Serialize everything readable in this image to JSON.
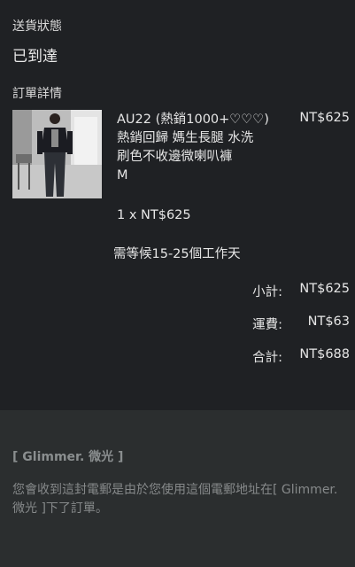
{
  "shipping": {
    "heading": "送貨狀態",
    "status": "已到達"
  },
  "order": {
    "heading": "訂單詳情",
    "item": {
      "name_line1": "AU22 (熱銷1000+♡♡♡)",
      "name_line2": "熱銷回歸 媽生長腿 水洗",
      "name_line3": "刷色不收邊微喇叭褲",
      "name_line4": "M",
      "price": "NT$625",
      "quantity_line": "1 x NT$625",
      "wait_note": "需等候15-25個工作天"
    },
    "summary": {
      "subtotal_label": "小計:",
      "subtotal_value": "NT$625",
      "shipping_label": "運費:",
      "shipping_value": "NT$63",
      "total_label": "合計:",
      "total_value": "NT$688"
    }
  },
  "footer": {
    "brand": "[ Glimmer. 微光 ]",
    "notice": "您會收到這封電郵是由於您使用這個電郵地址在[ Glimmer. 微光 ]下了訂單。"
  }
}
